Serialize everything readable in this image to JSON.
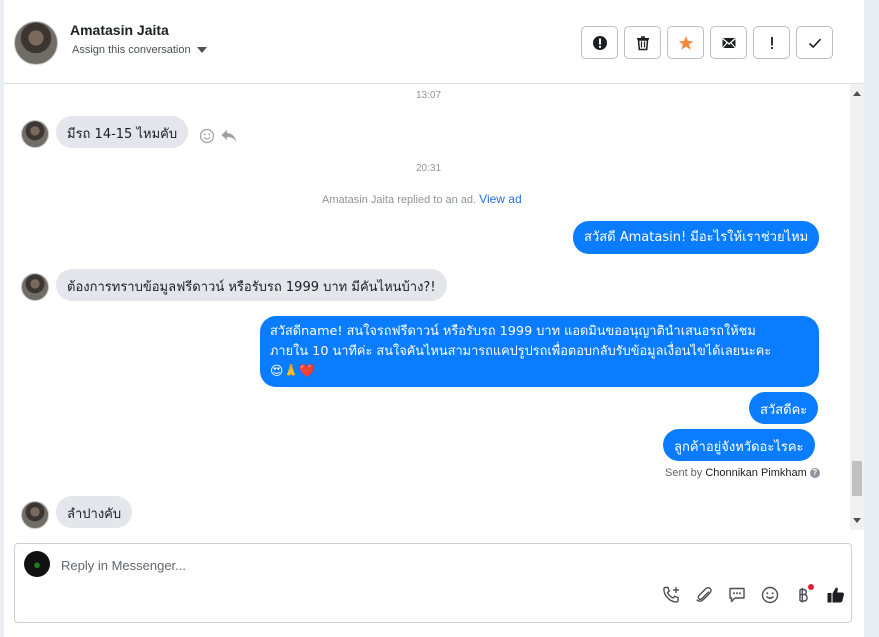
{
  "header": {
    "contact_name": "Amatasin Jaita",
    "assign_label": "Assign this conversation",
    "actions": [
      {
        "name": "report-button",
        "icon": "alert-circle-icon"
      },
      {
        "name": "delete-button",
        "icon": "trash-icon"
      },
      {
        "name": "star-button",
        "icon": "star-icon"
      },
      {
        "name": "mark-unread-button",
        "icon": "envelope-icon"
      },
      {
        "name": "spam-button",
        "icon": "exclamation-icon"
      },
      {
        "name": "done-button",
        "icon": "check-icon"
      }
    ]
  },
  "messages": {
    "time1": "13:07",
    "in1": "มีรถ 14-15 ไหมคับ",
    "time2": "20:31",
    "ad_notice": "Amatasin Jaita replied to an ad.",
    "view_ad": "View ad",
    "out1": "สวัสดี Amatasin! มีอะไรให้เราช่วยไหม",
    "in2": "ต้องการทราบข้อมูลฟรีดาวน์ หรือรับรถ 1999 บาท มีคันไหนบ้าง?!",
    "out2_line1": "สวัสดีname! สนใจรถฟรีดาวน์ หรือรับรถ 1999 บาท แอดมินขออนุญาตินำเสนอรถให้ชม",
    "out2_line2": "ภายใน 10 นาทีค่ะ สนใจคันไหนสามารถแคปรูปรถเพื่อตอบกลับรับข้อมูลเงื่อนไขได้เลยนะคะ",
    "out2_emoji": "😍🙏❤️",
    "out3": "สวัสดีคะ",
    "out4": "ลูกค้าอยู่จังหวัดอะไรคะ",
    "sent_by_prefix": "Sent by",
    "sent_by_name": "Chonnikan Pimkham",
    "in3": "ลำปางคับ"
  },
  "composer": {
    "placeholder": "Reply in Messenger..."
  },
  "colors": {
    "outgoing_bubble": "#0a7cff",
    "incoming_bubble": "#e4e6eb",
    "star": "#f5893a",
    "link": "#216fdb"
  }
}
